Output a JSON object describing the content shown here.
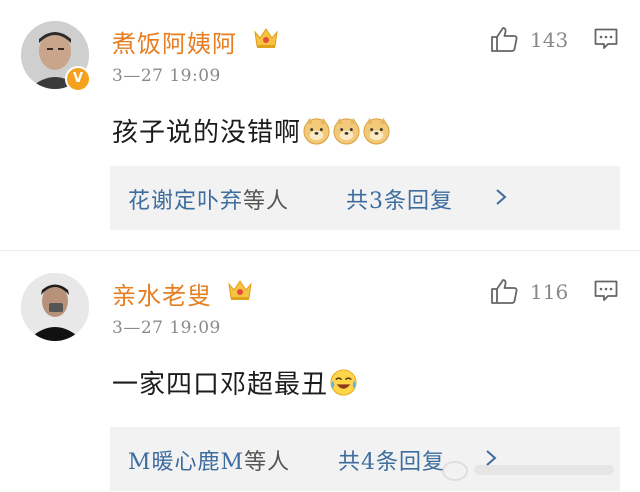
{
  "comments": [
    {
      "username": "煮饭阿姨阿",
      "timestamp": "3—27  19:09",
      "likes": "143",
      "text": "孩子说的没错啊",
      "emojis": [
        "doge-emoji",
        "doge-emoji",
        "doge-emoji"
      ],
      "replies": {
        "users": "花谢定卟弃",
        "users_suffix": "等人",
        "total": "共3条回复"
      }
    },
    {
      "username": "亲水老叟",
      "timestamp": "3—27  19:09",
      "likes": "116",
      "text": "一家四口邓超最丑",
      "emojis": [
        "laugh-cry-emoji"
      ],
      "replies": {
        "users": "M暖心鹿M",
        "users_suffix": "等人",
        "total": "共4条回复"
      }
    }
  ],
  "colors": {
    "username": "#e67e22",
    "reply_link": "#3d6c9f",
    "timestamp": "#8a8a8a",
    "reply_box_bg": "#f2f2f2"
  }
}
